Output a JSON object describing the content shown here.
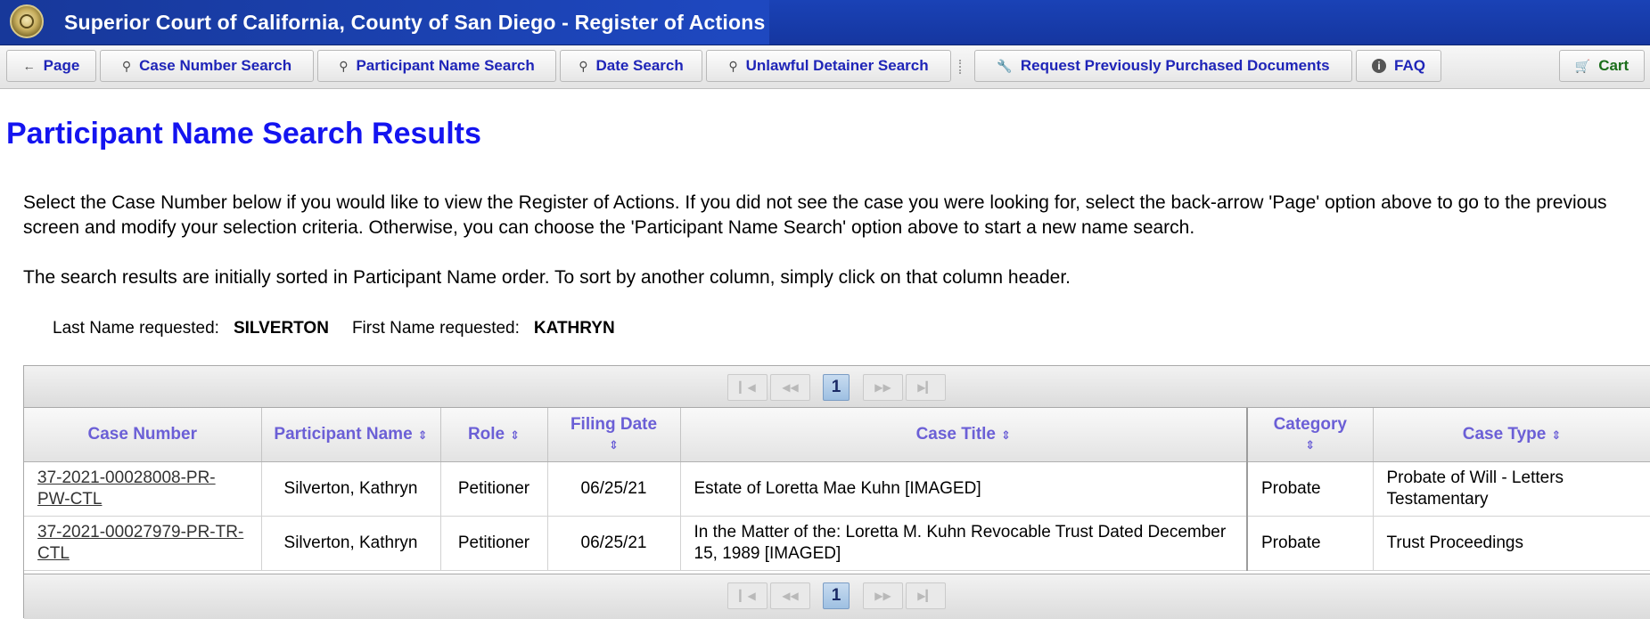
{
  "header": {
    "app_title": "Superior Court of California, County of San Diego  -  Register of Actions",
    "seal_icon": "county-seal-icon"
  },
  "toolbar": {
    "items": [
      {
        "label": "Page",
        "icon": "back-arrow-icon"
      },
      {
        "label": "Case Number Search",
        "icon": "search-icon"
      },
      {
        "label": "Participant Name Search",
        "icon": "search-icon"
      },
      {
        "label": "Date Search",
        "icon": "search-icon"
      },
      {
        "label": "Unlawful Detainer Search",
        "icon": "search-icon"
      },
      {
        "label": "Request Previously Purchased Documents",
        "icon": "wrench-icon"
      },
      {
        "label": "FAQ",
        "icon": "info-icon"
      },
      {
        "label": "Cart",
        "icon": "cart-icon"
      }
    ]
  },
  "page": {
    "title": "Participant Name Search Results",
    "intro": "Select the Case Number below if you would like to view the Register of Actions. If you did not see the case you were looking for, select the back-arrow 'Page' option above to go to the previous screen and modify your selection criteria. Otherwise, you can choose the 'Participant Name Search' option above to start a new name search.",
    "sort_note": "The search results are initially sorted in Participant Name order. To sort by another column, simply click on that column header.",
    "last_name_label": "Last Name requested:",
    "last_name_value": "SILVERTON",
    "first_name_label": "First Name requested:",
    "first_name_value": "KATHRYN"
  },
  "pager": {
    "current_page": "1"
  },
  "table": {
    "columns": [
      "Case Number",
      "Participant Name",
      "Role",
      "Filing Date",
      "Case Title",
      "Category",
      "Case Type"
    ],
    "rows": [
      {
        "case_number": "37-2021-00028008-PR-PW-CTL",
        "participant": "Silverton, Kathryn",
        "role": "Petitioner",
        "filing_date": "06/25/21",
        "case_title": "Estate of Loretta Mae Kuhn [IMAGED]",
        "category": "Probate",
        "case_type": "Probate of Will - Letters Testamentary"
      },
      {
        "case_number": "37-2021-00027979-PR-TR-CTL",
        "participant": "Silverton, Kathryn",
        "role": "Petitioner",
        "filing_date": "06/25/21",
        "case_title": "In the Matter of the: Loretta M. Kuhn Revocable Trust Dated December 15, 1989 [IMAGED]",
        "category": "Probate",
        "case_type": "Trust Proceedings"
      }
    ]
  },
  "colors": {
    "title_bar": "#1e48c0",
    "heading": "#1414f0",
    "toolbar_text": "#1f25b8",
    "column_header_text": "#6b5fd6",
    "cart_text": "#1b6e1b"
  }
}
